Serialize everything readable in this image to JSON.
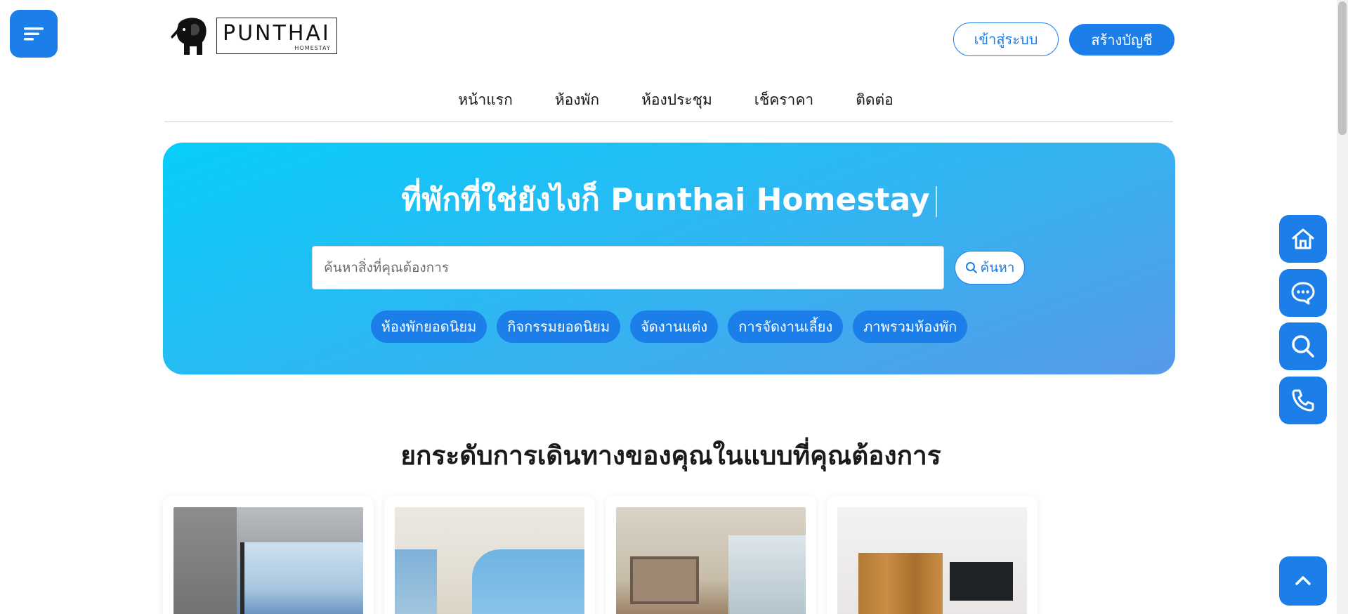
{
  "header": {
    "logo": {
      "brand": "PUNTHAI",
      "sub": "HOMESTAY"
    },
    "login_label": "เข้าสู่ระบบ",
    "register_label": "สร้างบัญชี"
  },
  "nav": {
    "items": [
      {
        "label": "หน้าแรก"
      },
      {
        "label": "ห้องพัก"
      },
      {
        "label": "ห้องประชุม"
      },
      {
        "label": "เช็คราคา"
      },
      {
        "label": "ติดต่อ"
      }
    ]
  },
  "hero": {
    "title": "ที่พักที่ใช่ยังไงก็ Punthai Homestay",
    "search_placeholder": "ค้นหาสิ่งที่คุณต้องการ",
    "search_value": "",
    "search_button": "ค้นหา",
    "chips": [
      {
        "label": "ห้องพักยอดนิยม"
      },
      {
        "label": "กิจกรรมยอดนิยม"
      },
      {
        "label": "จัดงานแต่ง"
      },
      {
        "label": "การจัดงานเลี้ยง"
      },
      {
        "label": "ภาพรวมห้องพัก"
      }
    ]
  },
  "section": {
    "heading": "ยกระดับการเดินทางของคุณในแบบที่คุณต้องการ"
  },
  "cards": [
    {
      "image": "room-photo-sea-view"
    },
    {
      "image": "room-photo-blue-bedroom"
    },
    {
      "image": "room-photo-city-view"
    },
    {
      "image": "room-photo-curtains"
    }
  ],
  "floating_actions": {
    "icons": [
      "home-icon",
      "chat-icon",
      "search-icon",
      "phone-icon",
      "chevron-up-icon"
    ]
  },
  "colors": {
    "primary": "#1c7ee8",
    "hero_gradient_start": "#07cdfb",
    "hero_gradient_end": "#5799e8"
  }
}
